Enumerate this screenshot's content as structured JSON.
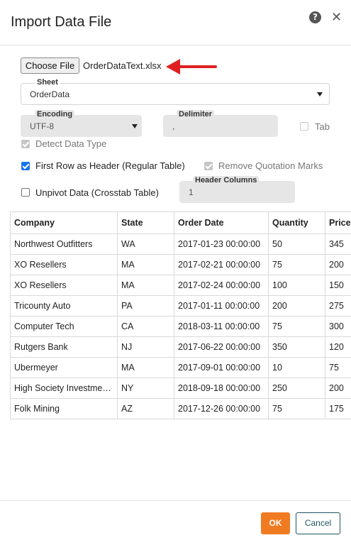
{
  "dialog": {
    "title": "Import Data File",
    "help_icon": "help-icon",
    "close_icon": "close-icon"
  },
  "file": {
    "choose_label": "Choose File",
    "filename": "OrderDataText.xlsx"
  },
  "sheet": {
    "label": "Sheet",
    "value": "OrderData"
  },
  "encoding": {
    "label": "Encoding",
    "value": "UTF-8"
  },
  "delimiter": {
    "label": "Delimiter",
    "value": ","
  },
  "tab": {
    "label": "Tab",
    "checked": false,
    "disabled": true
  },
  "detect_data_type": {
    "label": "Detect Data Type",
    "checked": true,
    "disabled": true
  },
  "first_row_header": {
    "label": "First Row as Header (Regular Table)",
    "checked": true
  },
  "remove_quotes": {
    "label": "Remove Quotation Marks",
    "checked": true,
    "disabled": true
  },
  "unpivot": {
    "label": "Unpivot Data (Crosstab Table)",
    "checked": false
  },
  "header_columns": {
    "label": "Header Columns",
    "value": "1"
  },
  "table": {
    "columns": [
      "Company",
      "State",
      "Order Date",
      "Quantity",
      "Price"
    ],
    "rows": [
      [
        "Northwest Outfitters",
        "WA",
        "2017-01-23 00:00:00",
        "50",
        "345"
      ],
      [
        "XO Resellers",
        "MA",
        "2017-02-21 00:00:00",
        "75",
        "200"
      ],
      [
        "XO Resellers",
        "MA",
        "2017-02-24 00:00:00",
        "100",
        "150"
      ],
      [
        "Tricounty Auto",
        "PA",
        "2017-01-11 00:00:00",
        "200",
        "275"
      ],
      [
        "Computer Tech",
        "CA",
        "2018-03-11 00:00:00",
        "75",
        "300"
      ],
      [
        "Rutgers Bank",
        "NJ",
        "2017-06-22 00:00:00",
        "350",
        "120"
      ],
      [
        "Ubermeyer",
        "MA",
        "2017-09-01 00:00:00",
        "10",
        "75"
      ],
      [
        "High Society Investments",
        "NY",
        "2018-09-18 00:00:00",
        "250",
        "200"
      ],
      [
        "Folk Mining",
        "AZ",
        "2017-12-26 00:00:00",
        "75",
        "175"
      ]
    ]
  },
  "footer": {
    "ok_label": "OK",
    "cancel_label": "Cancel"
  },
  "colors": {
    "accent": "#f07b22",
    "checkbox": "#1a73e8",
    "cancel_border": "#1f5460",
    "arrow": "#e02020"
  }
}
